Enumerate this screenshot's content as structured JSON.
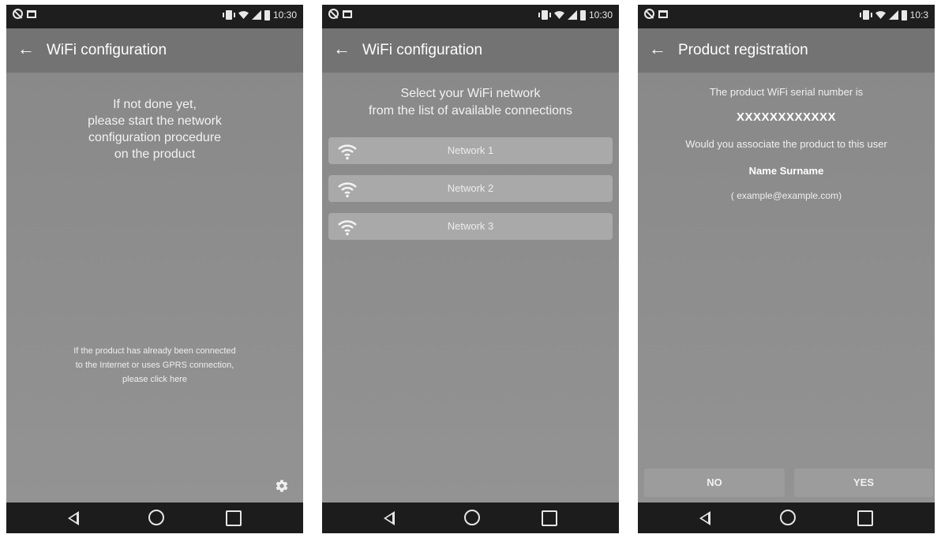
{
  "status_bar": {
    "time": [
      "10:30",
      "10:30",
      "10:3"
    ]
  },
  "screen1": {
    "title": "WiFi configuration",
    "instructions": "If not done yet,\nplease start the network\nconfiguration procedure\non the product",
    "hint": "If the product has already been connected\nto the Internet or uses GPRS connection,\nplease click here",
    "settings_icon": "gear-icon"
  },
  "screen2": {
    "title": "WiFi configuration",
    "instructions": "Select your WiFi network\nfrom the list of available connections",
    "networks": [
      {
        "label": "Network 1",
        "icon": "wifi-icon"
      },
      {
        "label": "Network 2",
        "icon": "wifi-icon"
      },
      {
        "label": "Network 3",
        "icon": "wifi-icon"
      }
    ]
  },
  "screen3": {
    "title": "Product registration",
    "serial_label": "The product WiFi serial number is",
    "serial_value": "XXXXXXXXXXXX",
    "question": "Would you associate the product to this user",
    "user_name": "Name Surname",
    "user_email": "( example@example.com)",
    "no_label": "NO",
    "yes_label": "YES"
  },
  "colors": {
    "status_bar": "#1e1e1e",
    "app_bar": "#737373",
    "background": "#8e8e8e",
    "list_item": "#a9a9a9",
    "nav_bar": "#1c1c1c"
  }
}
